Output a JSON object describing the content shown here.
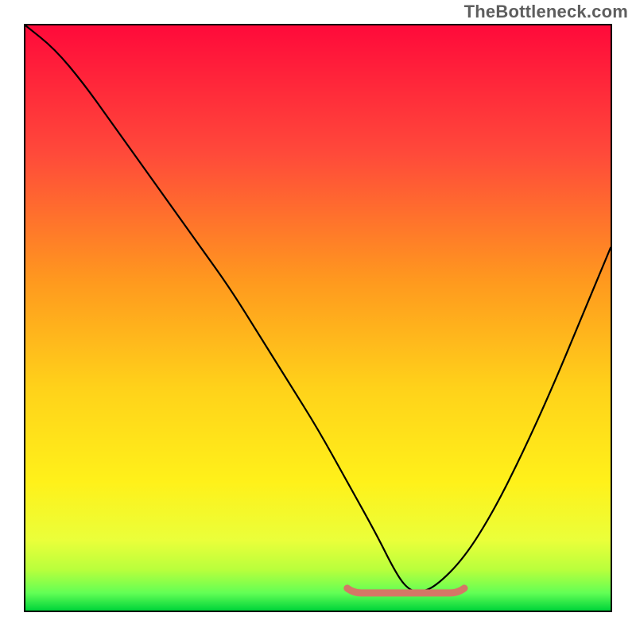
{
  "watermark": "TheBottleneck.com",
  "chart_data": {
    "type": "line",
    "title": "",
    "xlabel": "",
    "ylabel": "",
    "xlim": [
      0,
      100
    ],
    "ylim": [
      0,
      100
    ],
    "x": [
      0,
      5,
      10,
      15,
      20,
      25,
      30,
      35,
      40,
      45,
      50,
      55,
      60,
      63,
      65,
      67,
      70,
      75,
      80,
      85,
      90,
      95,
      100
    ],
    "values": [
      100,
      96,
      90,
      83,
      76,
      69,
      62,
      55,
      47,
      39,
      31,
      22,
      13,
      7,
      4,
      3,
      4,
      9,
      17,
      27,
      38,
      50,
      62
    ],
    "gradient": [
      {
        "offset": 0.0,
        "color": "#ff0a3a"
      },
      {
        "offset": 0.22,
        "color": "#ff4a3a"
      },
      {
        "offset": 0.44,
        "color": "#ff9a1e"
      },
      {
        "offset": 0.62,
        "color": "#ffd21a"
      },
      {
        "offset": 0.78,
        "color": "#fff11a"
      },
      {
        "offset": 0.88,
        "color": "#eaff3a"
      },
      {
        "offset": 0.93,
        "color": "#b9ff3c"
      },
      {
        "offset": 0.97,
        "color": "#62ff55"
      },
      {
        "offset": 1.0,
        "color": "#00d43a"
      }
    ],
    "marker": {
      "color": "#d47766",
      "x_start": 55,
      "x_end": 75,
      "y": 3
    }
  }
}
